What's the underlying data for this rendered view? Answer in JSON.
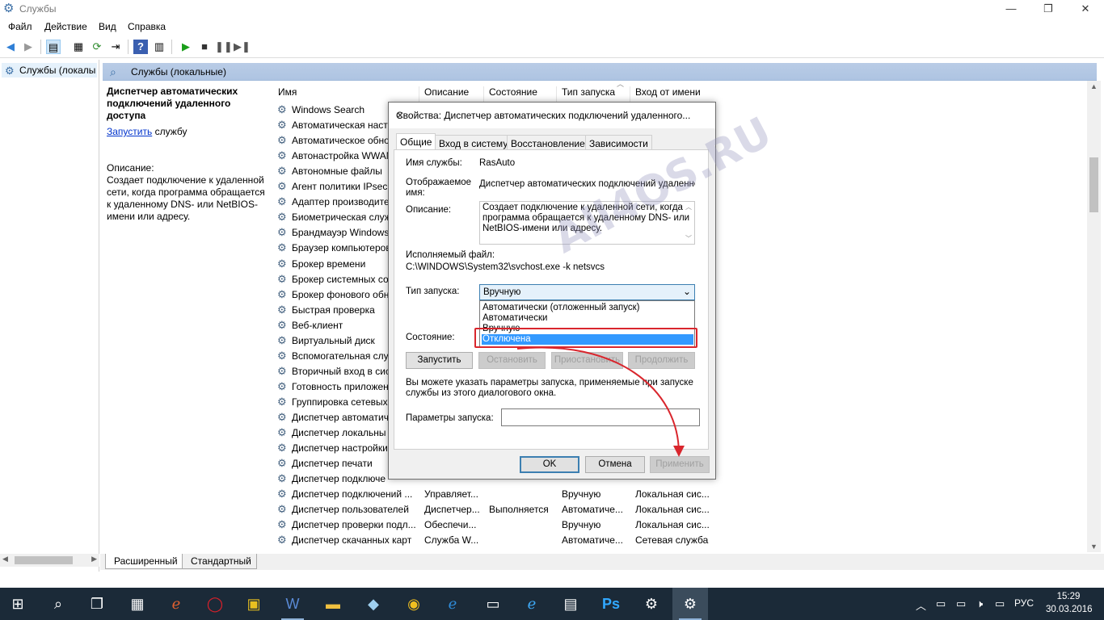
{
  "window": {
    "title": "Службы",
    "minimize": "—",
    "maximize": "❐",
    "close": "✕"
  },
  "menu": [
    "Файл",
    "Действие",
    "Вид",
    "Справка"
  ],
  "tree": {
    "node_label": "Службы (локалы"
  },
  "header": {
    "title": "Службы (локальные)"
  },
  "description_pane": {
    "service_name": "Диспетчер автоматических подключений удаленного доступа",
    "start_link": "Запустить",
    "start_suffix": " службу",
    "description_label": "Описание:",
    "description_text": "Создает подключение к удаленной сети, когда программа обращается к удаленному DNS- или NetBIOS-имени или адресу."
  },
  "columns": [
    "Имя",
    "Описание",
    "Состояние",
    "Тип запуска",
    "Вход от имени"
  ],
  "rows": [
    {
      "name": "Windows Search",
      "desc": "",
      "state": "",
      "type": "",
      "logon": ""
    },
    {
      "name": "Автоматическая настр",
      "desc": "",
      "state": "",
      "type": "",
      "logon": ""
    },
    {
      "name": "Автоматическое обно",
      "desc": "",
      "state": "",
      "type": "",
      "logon": ""
    },
    {
      "name": "Автонастройка WWAN",
      "desc": "",
      "state": "",
      "type": "",
      "logon": ""
    },
    {
      "name": "Автономные файлы",
      "desc": "",
      "state": "",
      "type": "",
      "logon": ""
    },
    {
      "name": "Агент политики IPsec",
      "desc": "",
      "state": "",
      "type": "",
      "logon": ""
    },
    {
      "name": "Адаптер производите",
      "desc": "",
      "state": "",
      "type": "",
      "logon": ""
    },
    {
      "name": "Биометрическая служ",
      "desc": "",
      "state": "",
      "type": "",
      "logon": ""
    },
    {
      "name": "Брандмауэр Windows",
      "desc": "",
      "state": "",
      "type": "",
      "logon": ""
    },
    {
      "name": "Браузер компьютеров",
      "desc": "",
      "state": "",
      "type": "",
      "logon": ""
    },
    {
      "name": "Брокер времени",
      "desc": "",
      "state": "",
      "type": "",
      "logon": ""
    },
    {
      "name": "Брокер системных со",
      "desc": "",
      "state": "",
      "type": "",
      "logon": ""
    },
    {
      "name": "Брокер фонового обн",
      "desc": "",
      "state": "",
      "type": "",
      "logon": ""
    },
    {
      "name": "Быстрая проверка",
      "desc": "",
      "state": "",
      "type": "",
      "logon": ""
    },
    {
      "name": "Веб-клиент",
      "desc": "",
      "state": "",
      "type": "",
      "logon": ""
    },
    {
      "name": "Виртуальный диск",
      "desc": "",
      "state": "",
      "type": "",
      "logon": ""
    },
    {
      "name": "Вспомогательная служ",
      "desc": "",
      "state": "",
      "type": "",
      "logon": ""
    },
    {
      "name": "Вторичный вход в сис",
      "desc": "",
      "state": "",
      "type": "",
      "logon": ""
    },
    {
      "name": "Готовность приложен",
      "desc": "",
      "state": "",
      "type": "",
      "logon": ""
    },
    {
      "name": "Группировка сетевых",
      "desc": "",
      "state": "",
      "type": "",
      "logon": ""
    },
    {
      "name": "Диспетчер автоматич",
      "desc": "",
      "state": "",
      "type": "",
      "logon": ""
    },
    {
      "name": "Диспетчер локальны",
      "desc": "",
      "state": "",
      "type": "",
      "logon": ""
    },
    {
      "name": "Диспетчер настройки",
      "desc": "",
      "state": "",
      "type": "",
      "logon": ""
    },
    {
      "name": "Диспетчер печати",
      "desc": "",
      "state": "",
      "type": "",
      "logon": ""
    },
    {
      "name": "Диспетчер подключе",
      "desc": "",
      "state": "",
      "type": "",
      "logon": ""
    },
    {
      "name": "Диспетчер подключений ...",
      "desc": "Управляет...",
      "state": "",
      "type": "Вручную",
      "logon": "Локальная сис..."
    },
    {
      "name": "Диспетчер пользователей",
      "desc": "Диспетчер...",
      "state": "Выполняется",
      "type": "Автоматиче...",
      "logon": "Локальная сис..."
    },
    {
      "name": "Диспетчер проверки подл...",
      "desc": "Обеспечи...",
      "state": "",
      "type": "Вручную",
      "logon": "Локальная сис..."
    },
    {
      "name": "Диспетчер скачанных карт",
      "desc": "Служба W...",
      "state": "",
      "type": "Автоматиче...",
      "logon": "Сетевая служба"
    }
  ],
  "bottom_tabs": [
    "Расширенный",
    "Стандартный"
  ],
  "dialog": {
    "title": "Свойства: Диспетчер автоматических подключений удаленного...",
    "tabs": [
      "Общие",
      "Вход в систему",
      "Восстановление",
      "Зависимости"
    ],
    "service_name_label": "Имя службы:",
    "service_name_value": "RasAuto",
    "display_name_label": "Отображаемое имя:",
    "display_name_value": "Диспетчер автоматических подключений удаленного",
    "description_label": "Описание:",
    "description_value": "Создает подключение к удаленной сети, когда программа обращается к удаленному DNS- или NetBIOS-имени или адресу.",
    "exe_label": "Исполняемый файл:",
    "exe_value": "C:\\WINDOWS\\System32\\svchost.exe -k netsvcs",
    "startup_label": "Тип запуска:",
    "startup_value": "Вручную",
    "dropdown_options": [
      "Автоматически (отложенный запуск)",
      "Автоматически",
      "Вручную",
      "Отключена"
    ],
    "selected_option": "Отключена",
    "state_label": "Состояние:",
    "btn_start": "Запустить",
    "btn_stop": "Остановить",
    "btn_pause": "Приостановить",
    "btn_resume": "Продолжить",
    "hint": "Вы можете указать параметры запуска, применяемые при запуске службы из этого диалогового окна.",
    "params_label": "Параметры запуска:",
    "ok": "OK",
    "cancel": "Отмена",
    "apply": "Применить"
  },
  "watermark": "All4OS.RU",
  "taskbar": {
    "lang": "РУС",
    "time": "15:29",
    "date": "30.03.2016"
  },
  "colors": {
    "highlight": "#3399ff",
    "annotation_red": "#d9262d",
    "taskbar": "#1b2a38"
  }
}
